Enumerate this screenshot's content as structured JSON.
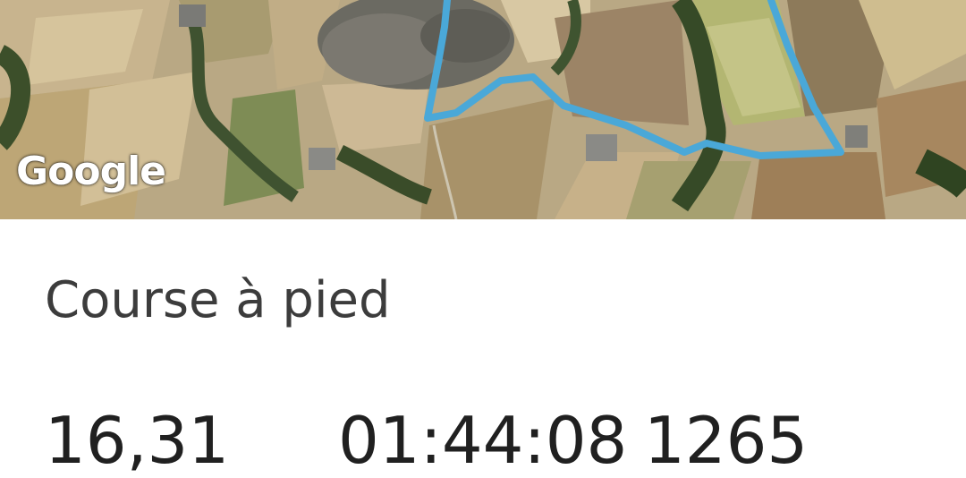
{
  "map": {
    "provider_logo": "Google",
    "route_color": "#4aa8d8"
  },
  "activity": {
    "type_label": "Course à pied"
  },
  "stats": {
    "distance": "16,31",
    "duration": "01:44:08",
    "calories": "1265"
  }
}
